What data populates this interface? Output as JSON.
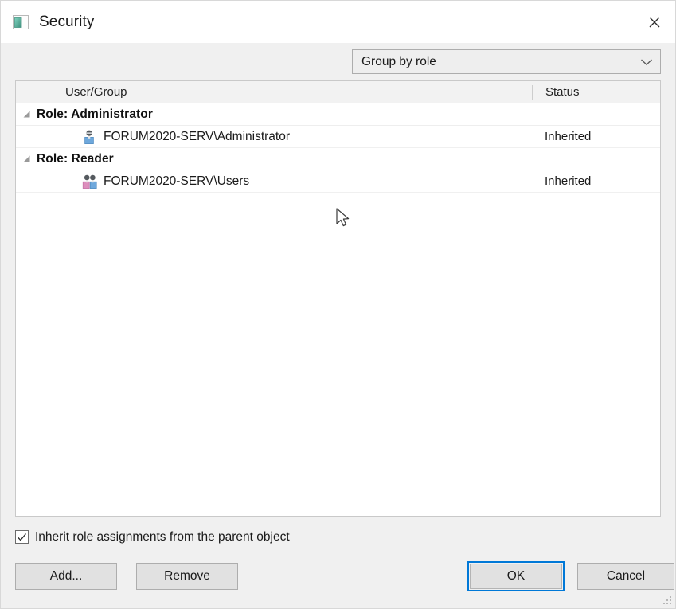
{
  "window": {
    "title": "Security",
    "icon": "window-pane-icon",
    "close_label": "✕",
    "accent_focus_color": "#0078d7"
  },
  "filter": {
    "label": "Group by role",
    "arrow_icon": "chevron-down-icon"
  },
  "list": {
    "columns": [
      {
        "key": "usergroup",
        "label": "User/Group"
      },
      {
        "key": "status",
        "label": "Status"
      }
    ],
    "groups": [
      {
        "label": "Role: Administrator",
        "expander_icon": "triangle-expanded-icon",
        "expanded": true,
        "rows": [
          {
            "name": "FORUM2020-SERV\\Administrator",
            "status": "Inherited",
            "icon": "single-user-icon"
          }
        ]
      },
      {
        "label": "Role: Reader",
        "expander_icon": "triangle-expanded-icon",
        "expanded": true,
        "rows": [
          {
            "name": "FORUM2020-SERV\\Users",
            "status": "Inherited",
            "icon": "user-group-icon"
          }
        ]
      }
    ]
  },
  "inherit": {
    "label": "Inherit role assignments from the parent object",
    "checked": true,
    "check_glyph": "✓"
  },
  "buttons": {
    "add": "Add...",
    "remove": "Remove",
    "ok": "OK",
    "cancel": "Cancel"
  },
  "decor": {
    "resize_grip_icon": "resize-grip-icon",
    "cursor_icon": "arrow-cursor-icon"
  }
}
